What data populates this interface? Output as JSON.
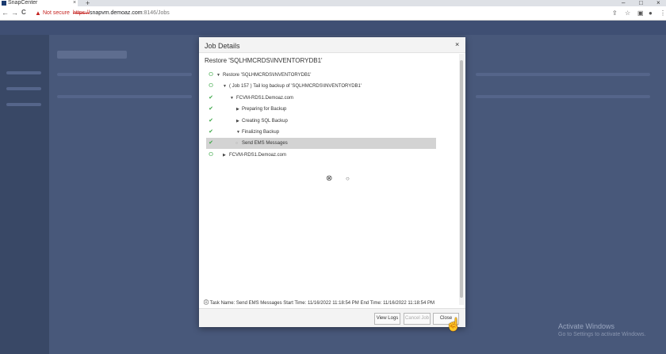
{
  "browser": {
    "tab_title": "SnapCenter",
    "tab_close": "×",
    "new_tab": "+",
    "warning_icon": "warning-triangle-icon",
    "not_secure": "Not secure",
    "url_protocol": "https://",
    "url_host": "snapvm.demoaz.com",
    "url_path": ":8146/Jobs",
    "back": "←",
    "forward": "→",
    "reload": "C",
    "share_icon": "⇪",
    "star_icon": "☆",
    "ext_icon": "▣",
    "profile_icon": "●",
    "menu_icon": "⋮",
    "min": "–",
    "max": "□",
    "close": "×"
  },
  "modal": {
    "title": "Job Details",
    "close_label": "×",
    "subtitle": "Restore 'SQLHMCRDS\\INVENTORYDB1'",
    "tree": [
      {
        "status": "⭘",
        "caret": "▼",
        "label": "Restore 'SQLHMCRDS\\INVENTORYDB1'"
      },
      {
        "status": "⭘",
        "caret": "▼",
        "label": "( Job 157 ) Tail log backup of 'SQLHMCRDS\\INVENTORYDB1'"
      },
      {
        "status": "✔",
        "caret": "▼",
        "label": "FCVM-RDS1.Demoaz.com"
      },
      {
        "status": "✔",
        "caret": "▶",
        "label": "Preparing for Backup"
      },
      {
        "status": "✔",
        "caret": "▶",
        "label": "Creating SQL Backup"
      },
      {
        "status": "✔",
        "caret": "▼",
        "label": "Finalizing Backup"
      },
      {
        "status": "✔",
        "caret": "○",
        "label": "Send EMS Messages"
      },
      {
        "status": "⭘",
        "caret": "▶",
        "label": "FCVM-RDS1.Demoaz.com"
      }
    ],
    "footer": "Task Name: Send EMS Messages Start Time: 11/16/2022 11:18:54 PM End Time: 11/16/2022 11:18:54 PM",
    "buttons": {
      "view_logs": "View Logs",
      "cancel_job": "Cancel Job",
      "close": "Close"
    }
  },
  "watermark": {
    "line1": "Activate Windows",
    "line2": "Go to Settings to activate Windows."
  },
  "colors": {
    "success": "#3aa745",
    "overlay": "#3e4d70"
  }
}
